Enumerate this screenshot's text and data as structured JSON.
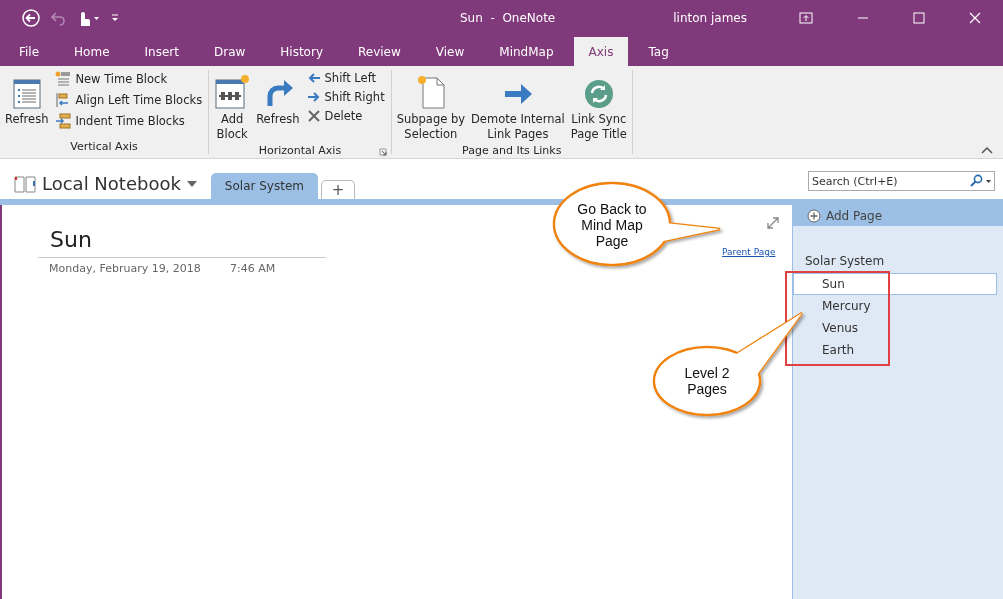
{
  "title_bar": {
    "title": "Sun  -  OneNote",
    "user": "linton james"
  },
  "menu_tabs": [
    {
      "label": "File",
      "selected": false
    },
    {
      "label": "Home",
      "selected": false
    },
    {
      "label": "Insert",
      "selected": false
    },
    {
      "label": "Draw",
      "selected": false
    },
    {
      "label": "History",
      "selected": false
    },
    {
      "label": "Review",
      "selected": false
    },
    {
      "label": "View",
      "selected": false
    },
    {
      "label": "MindMap",
      "selected": false
    },
    {
      "label": "Axis",
      "selected": true
    },
    {
      "label": "Tag",
      "selected": false
    }
  ],
  "ribbon_groups": [
    {
      "label": "Vertical Axis",
      "items": [
        {
          "kind": "large",
          "lines": [
            "Refresh"
          ]
        },
        {
          "kind": "small",
          "label": "New Time Block"
        },
        {
          "kind": "small",
          "label": "Align Left Time Blocks"
        },
        {
          "kind": "small",
          "label": "Indent Time Blocks"
        }
      ]
    },
    {
      "label": "Horizontal Axis",
      "items": [
        {
          "kind": "large",
          "lines": [
            "Add",
            "Block"
          ]
        },
        {
          "kind": "large",
          "lines": [
            "Refresh"
          ]
        },
        {
          "kind": "small",
          "label": "Shift Left"
        },
        {
          "kind": "small",
          "label": "Shift Right"
        },
        {
          "kind": "small",
          "label": "Delete"
        }
      ]
    },
    {
      "label": "Page and Its Links",
      "items": [
        {
          "kind": "large",
          "lines": [
            "Subpage by",
            "Selection"
          ]
        },
        {
          "kind": "large",
          "lines": [
            "Demote Internal",
            "Link Pages"
          ]
        },
        {
          "kind": "large",
          "lines": [
            "Link Sync",
            "Page Title"
          ]
        }
      ]
    }
  ],
  "notebook": {
    "name": "Local Notebook",
    "section_tabs": [
      {
        "label": "Solar System",
        "selected": true
      }
    ],
    "new_tab": "+"
  },
  "search": {
    "placeholder": "Search (Ctrl+E)"
  },
  "page": {
    "title": "Sun",
    "date": "Monday, February 19, 2018",
    "time": "7:46 AM",
    "link": "Parent Page"
  },
  "page_list": {
    "add_page": "Add Page",
    "section": "Solar System",
    "pages": [
      {
        "label": "Sun",
        "selected": true
      },
      {
        "label": "Mercury",
        "selected": false
      },
      {
        "label": "Venus",
        "selected": false
      },
      {
        "label": "Earth",
        "selected": false
      }
    ]
  },
  "callouts": [
    {
      "text": "Go Back to Mind Map Page"
    },
    {
      "text": "Level 2 Pages"
    }
  ]
}
